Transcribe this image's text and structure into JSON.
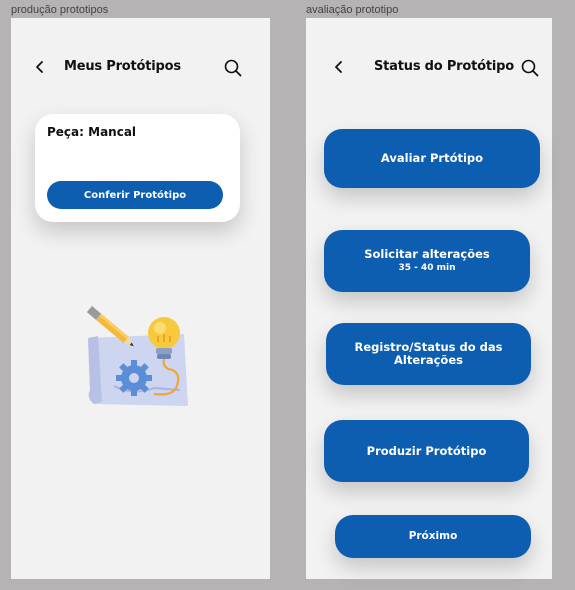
{
  "frames": {
    "production": {
      "label": "produção prototipos",
      "title": "Meus Protótipos",
      "card": {
        "title": "Peça: Mancal",
        "button": "Conferir Protótipo"
      }
    },
    "evaluation": {
      "label": "avaliação prototipo",
      "title": "Status do Protótipo",
      "buttons": {
        "evaluate": "Avaliar Prtótipo",
        "request": "Solicitar alterações",
        "request_sub": "35 - 40 min",
        "registry": "Registro/Status do das Alterações",
        "produce": "Produzir Protótipo",
        "next": "Próximo"
      }
    }
  },
  "icons": [
    "back-arrow-icon",
    "search-icon",
    "blueprint-illustration"
  ],
  "colors": {
    "accent": "#0d5db0",
    "background": "#b5b3b4",
    "frame": "#f2f2f2"
  }
}
